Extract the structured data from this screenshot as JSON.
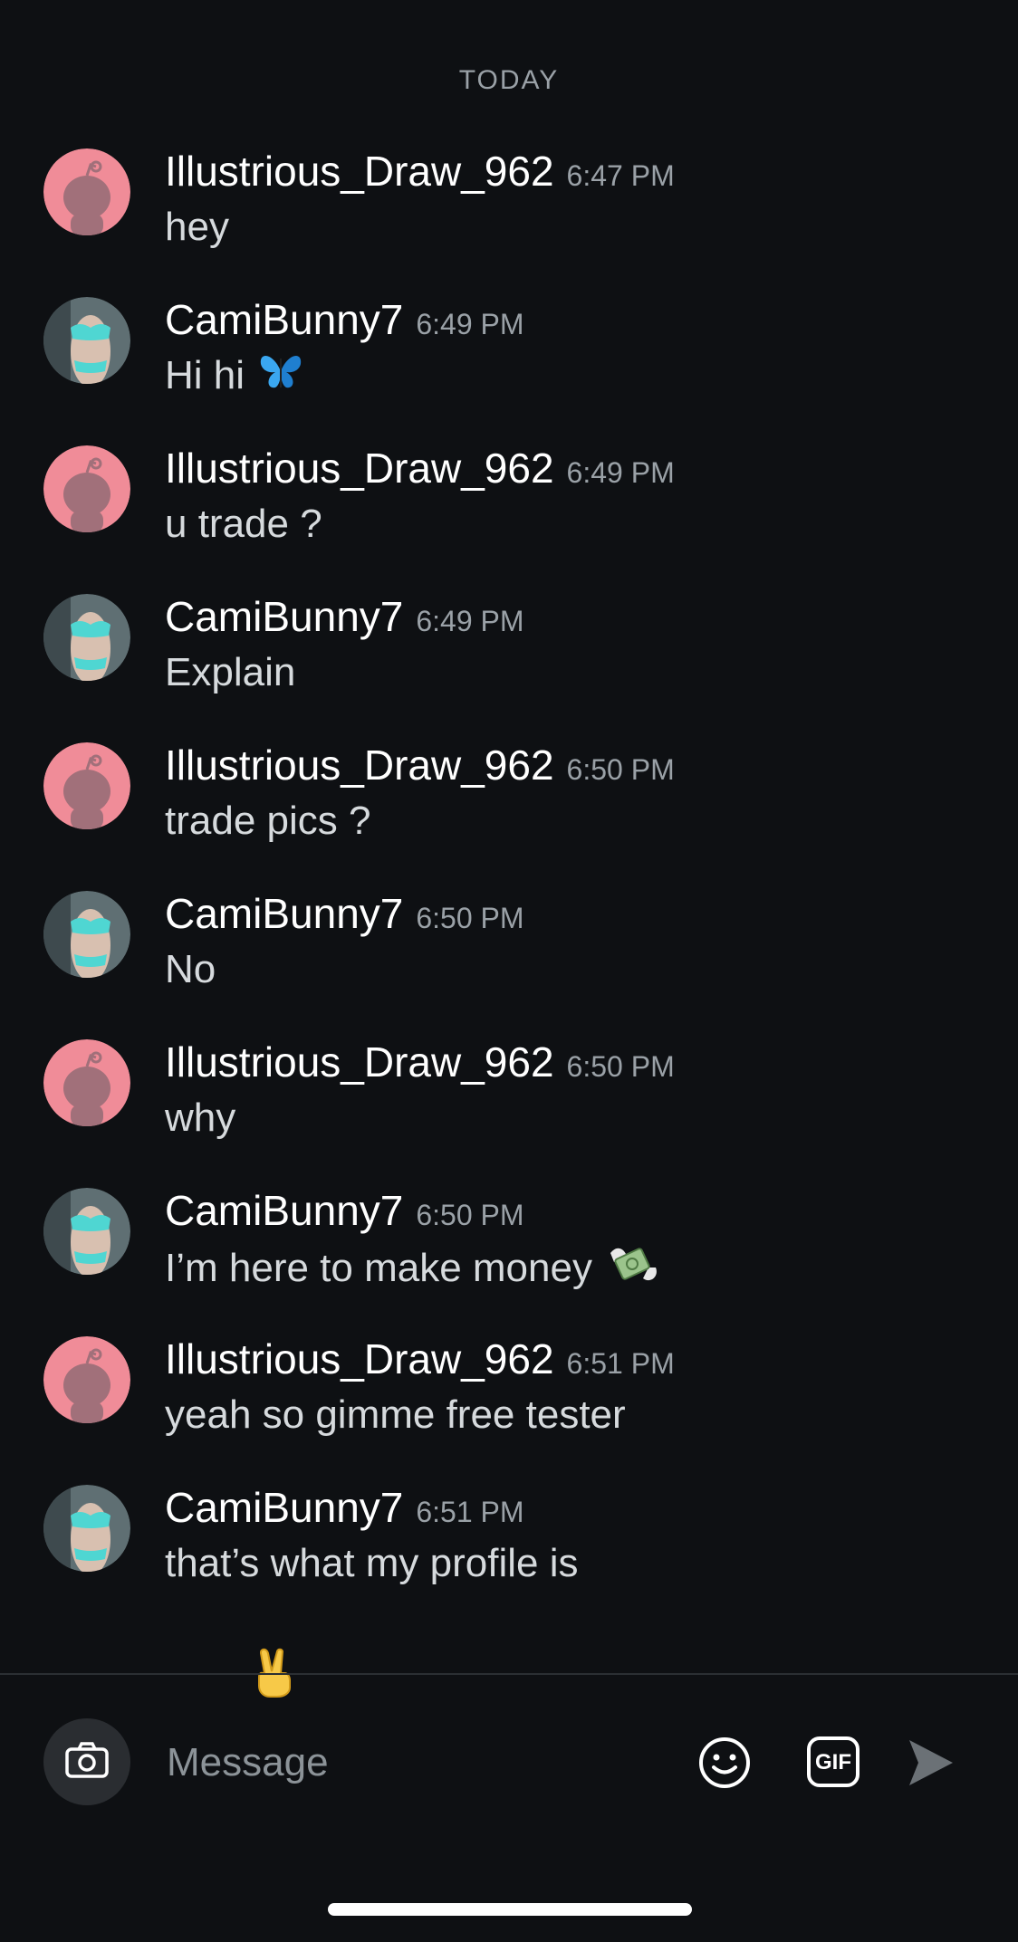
{
  "date_divider": "TODAY",
  "colors": {
    "background": "#0e1013",
    "username": "#ffffff",
    "message_text": "#d6dadd",
    "timestamp": "#9aa1a7",
    "avatar_pink": "#f08c98"
  },
  "messages": [
    {
      "user": "Illustrious_Draw_962",
      "time": "6:47 PM",
      "text": "hey",
      "avatar": "snoo-avatar"
    },
    {
      "user": "CamiBunny7",
      "time": "6:49 PM",
      "text": "Hi hi",
      "emoji": "butterfly-emoji",
      "avatar": "photo-avatar"
    },
    {
      "user": "Illustrious_Draw_962",
      "time": "6:49 PM",
      "text": "u trade ?",
      "avatar": "snoo-avatar"
    },
    {
      "user": "CamiBunny7",
      "time": "6:49 PM",
      "text": "Explain",
      "avatar": "photo-avatar"
    },
    {
      "user": "Illustrious_Draw_962",
      "time": "6:50 PM",
      "text": "trade pics ?",
      "avatar": "snoo-avatar"
    },
    {
      "user": "CamiBunny7",
      "time": "6:50 PM",
      "text": "No",
      "avatar": "photo-avatar"
    },
    {
      "user": "Illustrious_Draw_962",
      "time": "6:50 PM",
      "text": "why",
      "avatar": "snoo-avatar"
    },
    {
      "user": "CamiBunny7",
      "time": "6:50 PM",
      "text": "I’m here to make money",
      "emoji": "money-with-wings-emoji",
      "avatar": "photo-avatar"
    },
    {
      "user": "Illustrious_Draw_962",
      "time": "6:51 PM",
      "text": "yeah so gimme free tester",
      "avatar": "snoo-avatar"
    },
    {
      "user": "CamiBunny7",
      "time": "6:51 PM",
      "text": "that’s what my profile is",
      "emoji_line": "victory-hand-emoji",
      "avatar": "photo-avatar"
    }
  ],
  "composer": {
    "placeholder": "Message",
    "camera_icon": "camera-icon",
    "emoji_icon": "smiley-icon",
    "gif_label": "GIF",
    "send_icon": "send-arrow-icon"
  }
}
